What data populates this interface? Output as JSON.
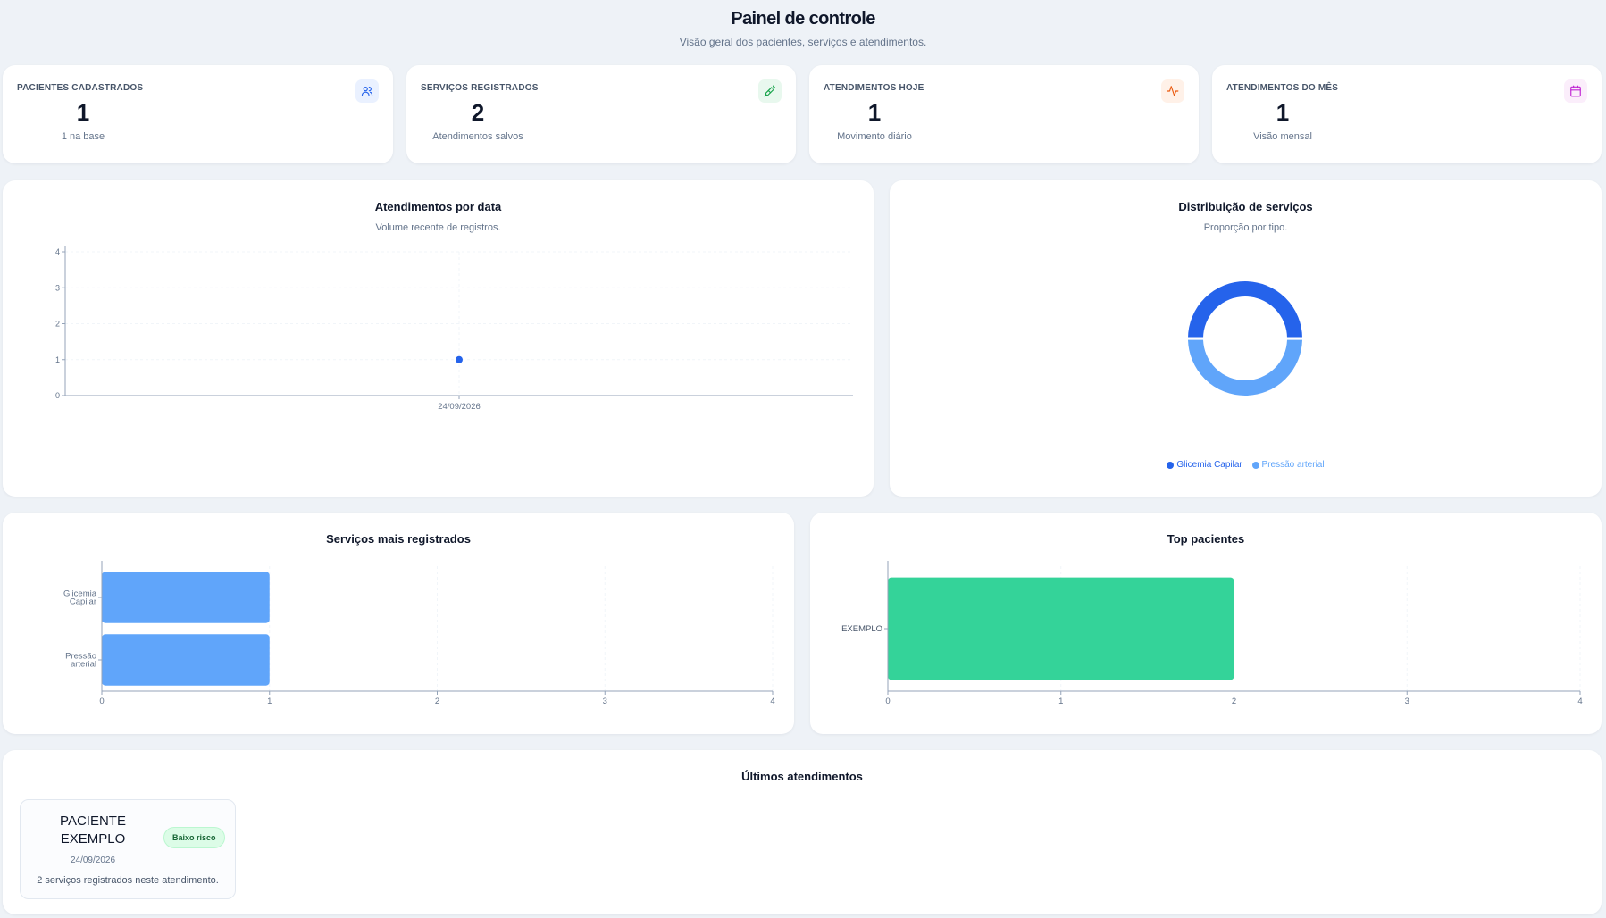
{
  "header": {
    "title": "Painel de controle",
    "subtitle": "Visão geral dos pacientes, serviços e atendimentos."
  },
  "stats": [
    {
      "label": "PACIENTES CADASTRADOS",
      "value": "1",
      "sub": "1 na base",
      "icon": "users-icon",
      "color": "#2563eb",
      "bg": "#eaf1ff"
    },
    {
      "label": "SERVIÇOS REGISTRADOS",
      "value": "2",
      "sub": "Atendimentos salvos",
      "icon": "syringe-icon",
      "color": "#16a34a",
      "bg": "#e8f8ee"
    },
    {
      "label": "ATENDIMENTOS HOJE",
      "value": "1",
      "sub": "Movimento diário",
      "icon": "activity-icon",
      "color": "#ea580c",
      "bg": "#fff1e8"
    },
    {
      "label": "ATENDIMENTOS DO MÊS",
      "value": "1",
      "sub": "Visão mensal",
      "icon": "calendar-icon",
      "color": "#c026d3",
      "bg": "#fbeefb"
    }
  ],
  "line_chart": {
    "title": "Atendimentos por data",
    "subtitle": "Volume recente de registros."
  },
  "donut_chart": {
    "title": "Distribuição de serviços",
    "subtitle": "Proporção por tipo."
  },
  "services_chart": {
    "title": "Serviços mais registrados"
  },
  "patients_chart": {
    "title": "Top pacientes"
  },
  "recent": {
    "title": "Últimos atendimentos",
    "items": [
      {
        "name": "PACIENTE EXEMPLO",
        "date": "24/09/2026",
        "badge": "Baixo risco",
        "desc": "2 serviços registrados neste atendimento."
      }
    ]
  },
  "chart_data": [
    {
      "type": "scatter",
      "x": [
        "24/09/2026"
      ],
      "y": [
        1
      ],
      "ylim": [
        0,
        4
      ],
      "yticks": [
        0,
        1,
        2,
        3,
        4
      ],
      "grid": true,
      "color": "#2563eb"
    },
    {
      "type": "pie",
      "labels": [
        "Glicemia Capilar",
        "Pressão arterial"
      ],
      "values": [
        1,
        1
      ],
      "colors": [
        "#2563eb",
        "#60a5fa"
      ],
      "legend": "bottom"
    },
    {
      "type": "bar",
      "orientation": "horizontal",
      "categories": [
        "Glicemia Capilar",
        "Pressão arterial"
      ],
      "values": [
        1,
        1
      ],
      "xlim": [
        0,
        4
      ],
      "xticks": [
        0,
        1,
        2,
        3,
        4
      ],
      "color": "#60a5fa"
    },
    {
      "type": "bar",
      "orientation": "horizontal",
      "categories": [
        "EXEMPLO"
      ],
      "values": [
        2
      ],
      "xlim": [
        0,
        4
      ],
      "xticks": [
        0,
        1,
        2,
        3,
        4
      ],
      "color": "#34d399"
    }
  ]
}
